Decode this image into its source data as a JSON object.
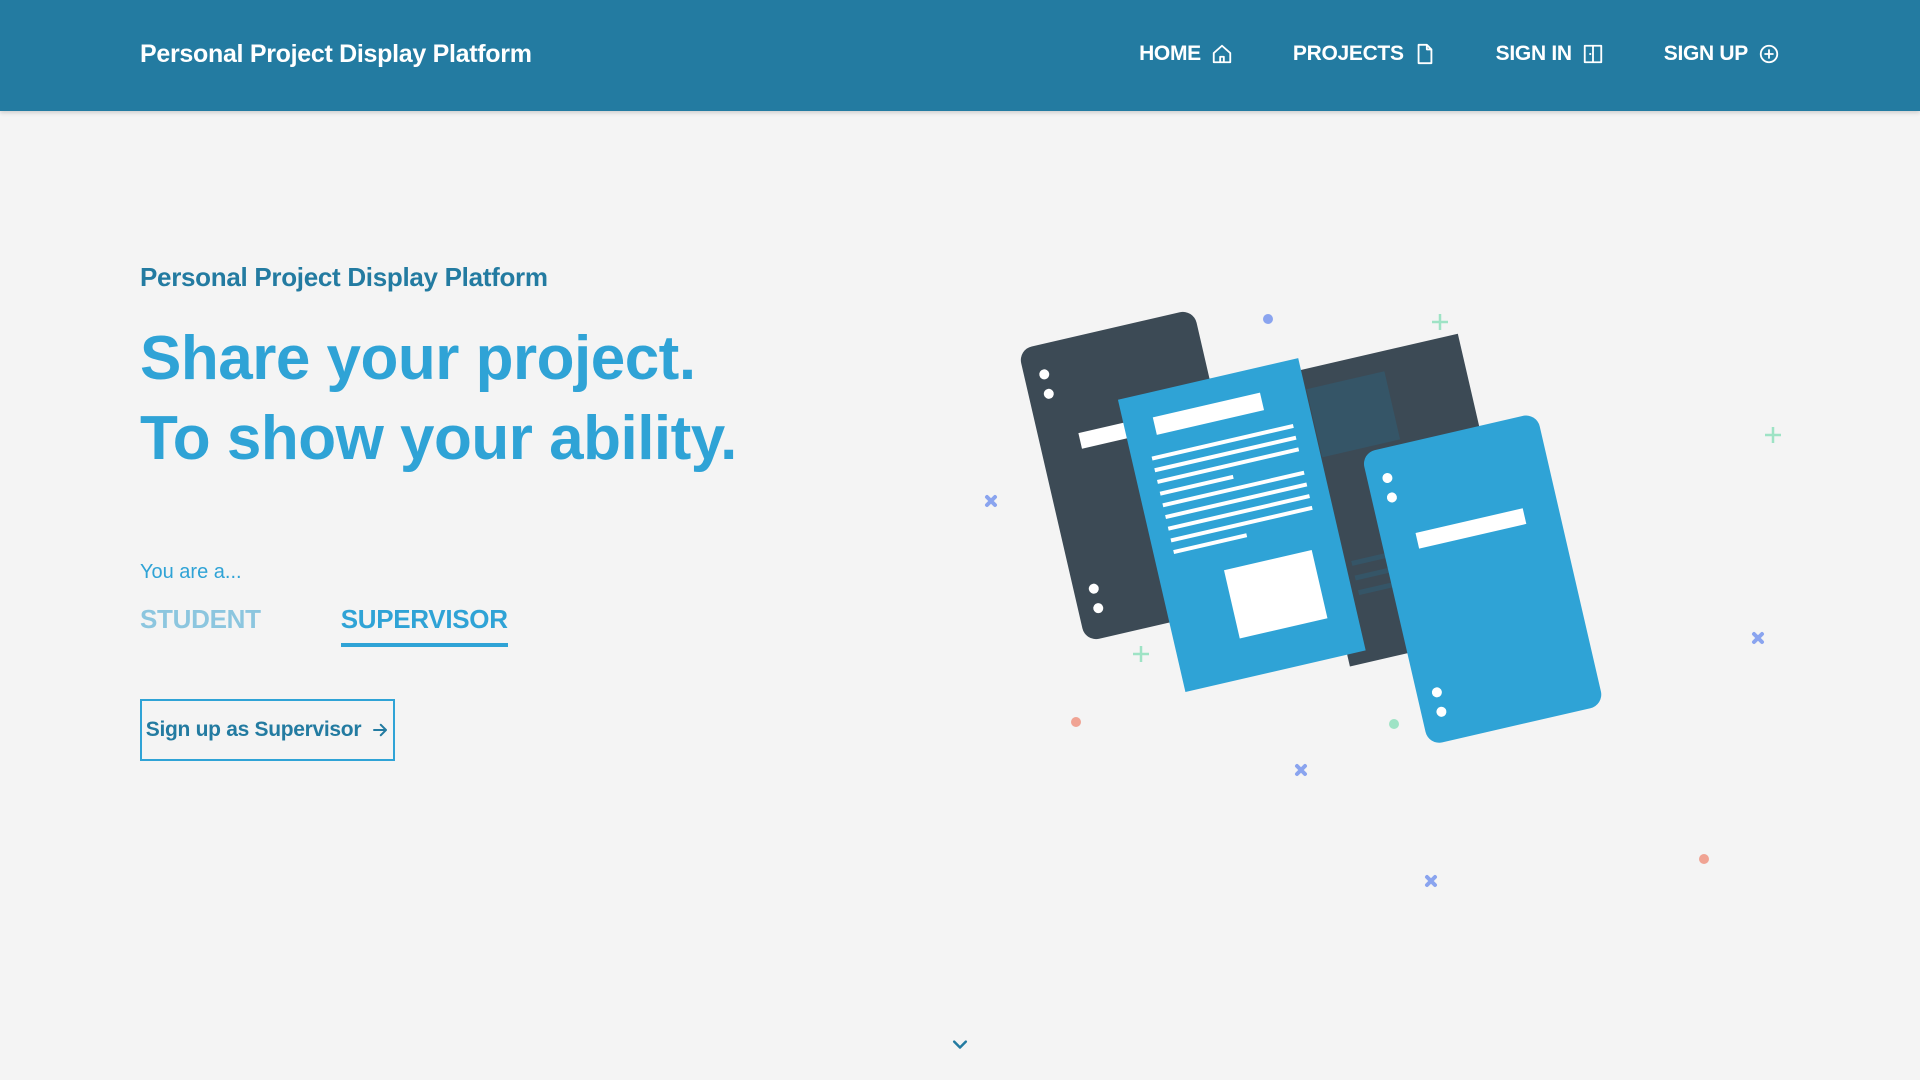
{
  "header": {
    "brand": "Personal Project Display Platform",
    "nav": [
      {
        "label": "HOME",
        "icon": "home-icon"
      },
      {
        "label": "PROJECTS",
        "icon": "document-icon"
      },
      {
        "label": "SIGN IN",
        "icon": "door-icon"
      },
      {
        "label": "SIGN UP",
        "icon": "plus-circle-icon"
      }
    ]
  },
  "hero": {
    "eyebrow": "Personal Project Display Platform",
    "headline_line1": "Share your project.",
    "headline_line2": "To show your ability.",
    "role_prompt": "You are a...",
    "roles": [
      "STUDENT",
      "SUPERVISOR"
    ],
    "selected_role": "SUPERVISOR",
    "cta_label": "Sign up as Supervisor"
  },
  "illustration": {
    "name": "documents-illustration"
  },
  "scroll": {
    "icon": "chevron-down-icon"
  },
  "colors": {
    "header_bg": "#237ba1",
    "accent": "#2fa3d6",
    "dark_doc": "#3c4a55",
    "background": "#f4f4f4"
  }
}
